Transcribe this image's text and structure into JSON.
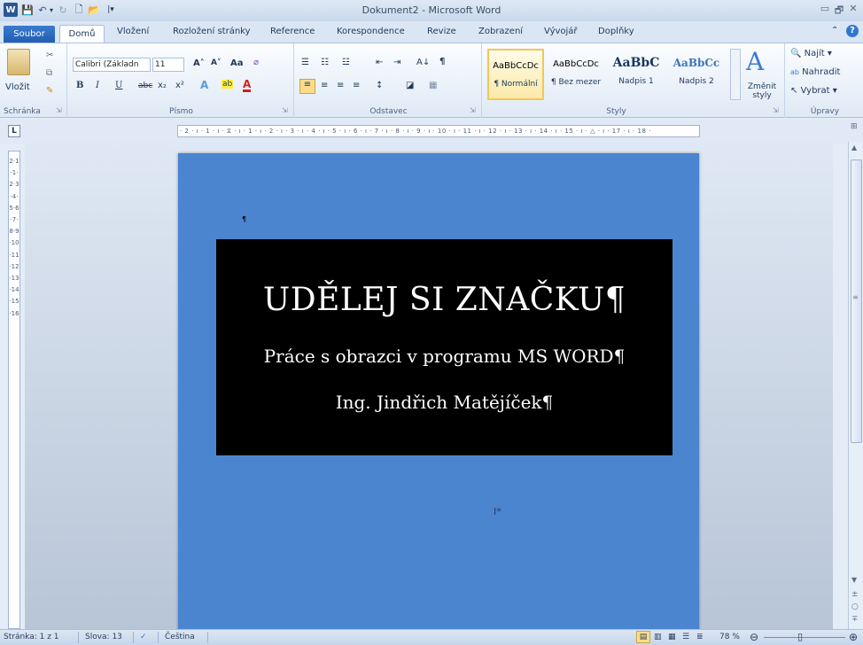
{
  "window": {
    "title": "Dokument2 - Microsoft Word",
    "min": "▭",
    "max": "🗗",
    "close": "✕"
  },
  "qat": {
    "word_icon": "W",
    "save": "💾",
    "undo": "↶",
    "undo_drop": "▾",
    "redo": "↻",
    "new": "🗋",
    "open": "📂",
    "customize": "|▾"
  },
  "tabs": {
    "file": "Soubor",
    "home": "Domů",
    "insert": "Vložení",
    "layout": "Rozložení stránky",
    "references": "Reference",
    "mailings": "Korespondence",
    "review": "Revize",
    "view": "Zobrazení",
    "developer": "Vývojář",
    "addins": "Doplňky",
    "help": "?",
    "minimize_ribbon": "⌃"
  },
  "ribbon": {
    "clipboard": {
      "label": "Schránka",
      "paste": "Vložit",
      "launcher": "⇲"
    },
    "font": {
      "label": "Písmo",
      "name": "Calibri (Základn",
      "size": "11",
      "grow": "A˄",
      "shrink": "A˅",
      "case": "Aa",
      "clear": "⌀",
      "bold": "B",
      "italic": "I",
      "underline": "U",
      "strike": "abc",
      "sub": "x₂",
      "sup": "x²",
      "effects": "A",
      "highlight": "ab",
      "color": "A",
      "launcher": "⇲"
    },
    "paragraph": {
      "label": "Odstavec",
      "bullets": "☰",
      "numbering": "☷",
      "multilevel": "☳",
      "decrease": "⇤",
      "increase": "⇥",
      "sort": "A↓",
      "show_marks": "¶",
      "align_left": "≡",
      "center": "≡",
      "align_right": "≡",
      "justify": "≡",
      "spacing": "↕",
      "shading": "◪",
      "borders": "▦",
      "launcher": "⇲"
    },
    "styles": {
      "label": "Styly",
      "items": [
        {
          "preview": "AaBbCcDc",
          "name": "¶ Normální"
        },
        {
          "preview": "AaBbCcDc",
          "name": "¶ Bez mezer"
        },
        {
          "preview": "AaBbC",
          "name": "Nadpis 1"
        },
        {
          "preview": "AaBbCc",
          "name": "Nadpis 2"
        }
      ],
      "change_icon": "A",
      "change": "Změnit styly",
      "launcher": "⇲"
    },
    "editing": {
      "label": "Úpravy",
      "find": "Najít",
      "replace": "Nahradit",
      "select": "Vybrat"
    }
  },
  "ruler": {
    "tab_selector": "L",
    "h_marks": "· 2 · ı · 1 · ı · ⧖ · ı · 1 · ı · 2 · ı · 3 · ı · 4 · ı · 5 · ı · 6 · ı · 7 · ı · 8 · ı · 9 · ı · 10 · ı · 11 · ı · 12 · ı · 13 · ı · 14 · ı · 15 · ı · △ · ı · 17 · ı · 18 ·",
    "v_marks": "2·1·1·2·3·4·5·6·7·8·9·10·11·12·13·14·15·16"
  },
  "document": {
    "pilcrow": "¶",
    "title": "UDĚLEJ SI ZNAČKU¶",
    "subtitle": "Práce s obrazci v programu MS WORD¶",
    "author": "Ing. Jindřich Matějíček¶",
    "cursor": "I*",
    "page_color": "#4b85d0",
    "box_color": "#000000"
  },
  "scrollbar": {
    "up": "▲",
    "down": "▼",
    "prev_page": "±",
    "browse": "○",
    "next_page": "∓",
    "view_ruler": "⊞",
    "splitter": "≡"
  },
  "status": {
    "page": "Stránka: 1 z 1",
    "words": "Slova: 13",
    "proof_icon": "✓",
    "language": "Čeština",
    "zoom": "78 %",
    "zoom_out": "⊖",
    "zoom_in": "⊕",
    "zoom_percent": 78,
    "view_print": "▤",
    "view_full": "▥",
    "view_web": "▦",
    "view_outline": "☰",
    "view_draft": "≣",
    "slider_handle": "▯"
  }
}
